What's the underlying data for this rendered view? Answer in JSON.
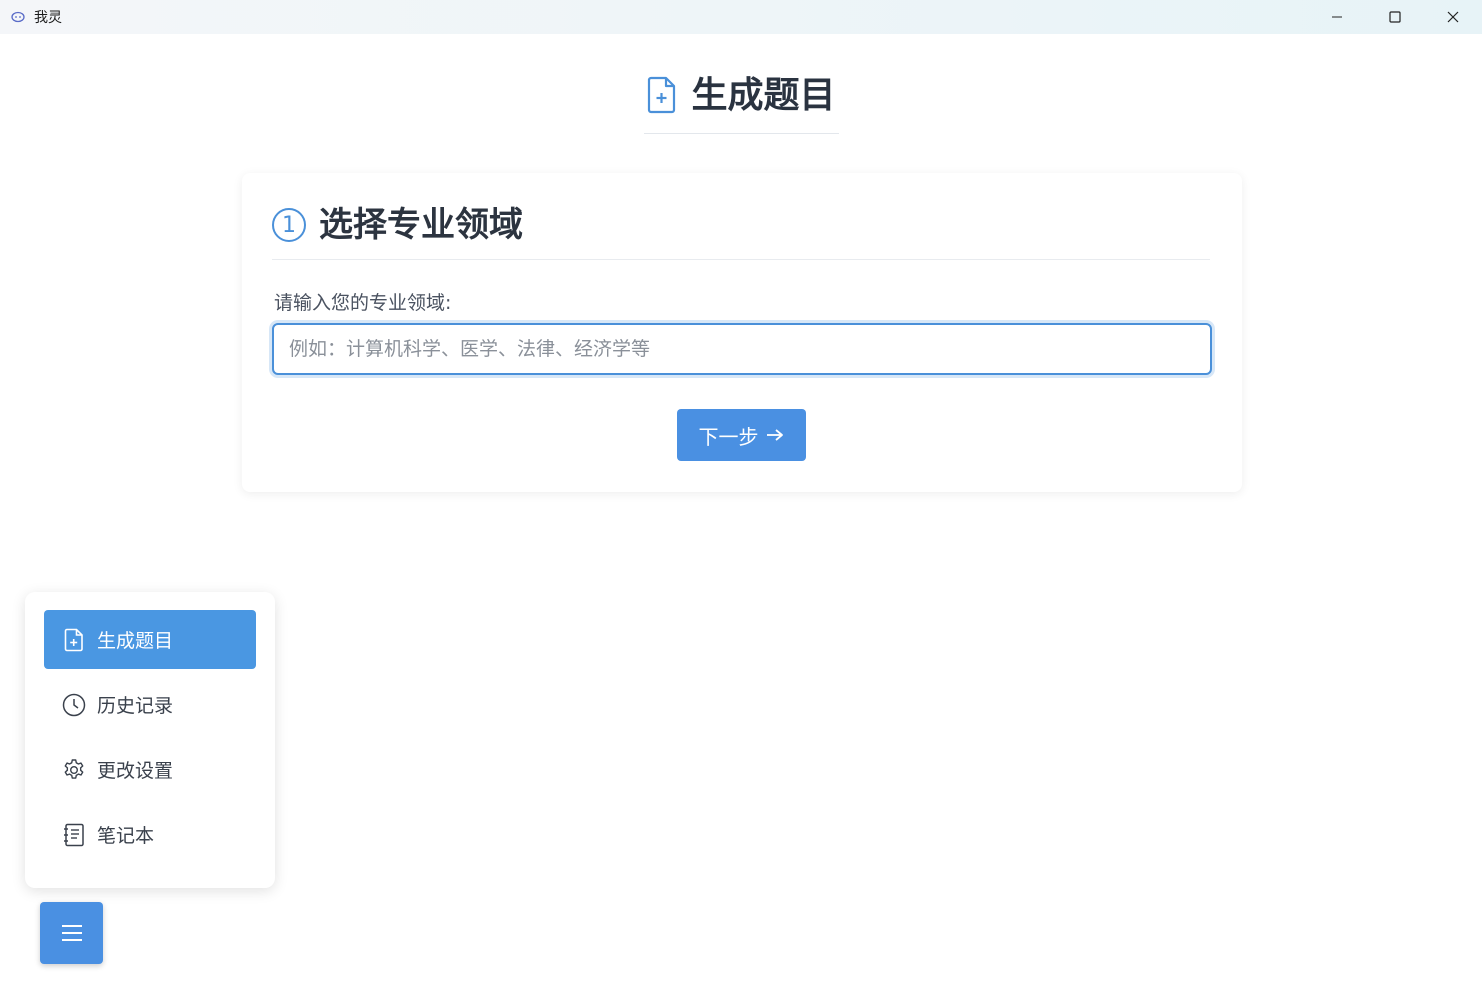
{
  "window": {
    "title": "我灵",
    "controls": [
      "minimize-icon",
      "maximize-icon",
      "close-icon"
    ]
  },
  "header": {
    "icon": "file-plus-icon",
    "title": "生成题目"
  },
  "step": {
    "number": "1",
    "title": "选择专业领域",
    "field_label": "请输入您的专业领域:",
    "input_value": "",
    "input_placeholder": "例如：计算机科学、医学、法律、经济学等",
    "next_label": "下一步",
    "next_icon": "arrow-right-icon"
  },
  "menu": {
    "items": [
      {
        "label": "生成题目",
        "icon": "file-plus-icon",
        "active": true
      },
      {
        "label": "历史记录",
        "icon": "clock-icon",
        "active": false
      },
      {
        "label": "更改设置",
        "icon": "gear-icon",
        "active": false
      },
      {
        "label": "笔记本",
        "icon": "notebook-icon",
        "active": false
      }
    ],
    "toggle_icon": "hamburger-icon"
  },
  "colors": {
    "accent": "#4a90e2",
    "menu_active": "#4a97e2",
    "title_text": "#2a3340"
  }
}
